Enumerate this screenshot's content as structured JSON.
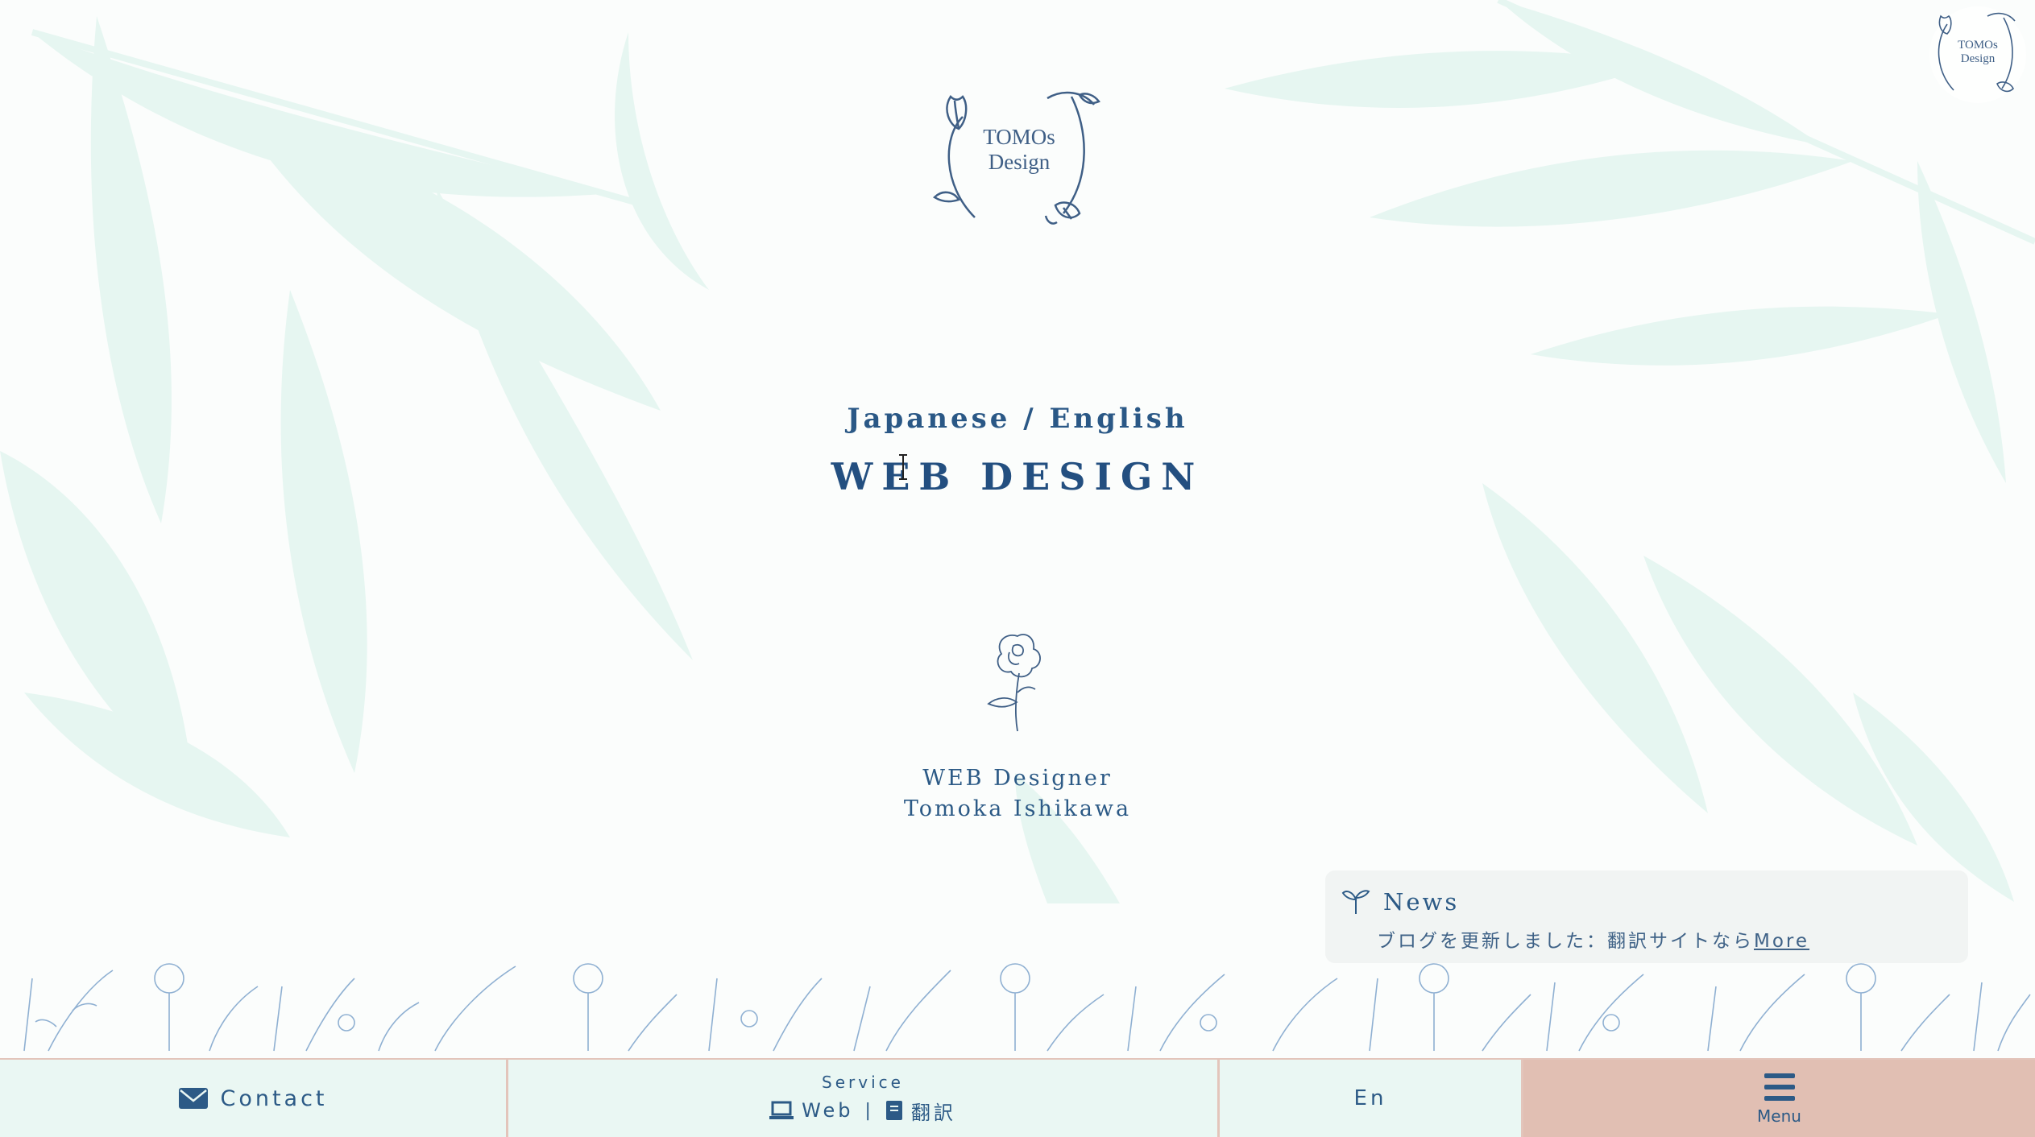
{
  "colors": {
    "background": "#fbfdfc",
    "leaf": "#e6f6f1",
    "primary_text": "#2a5886",
    "bar_background": "#eaf7f3",
    "menu_background": "#e1bfb3",
    "bar_border": "#e3c5bb"
  },
  "logo": {
    "line1": "TOMOs",
    "line2": "Design"
  },
  "corner_logo": {
    "line1": "TOMOs",
    "line2": "Design"
  },
  "hero": {
    "subtitle": "Japanese / English",
    "headline": "WEB DESIGN"
  },
  "profile": {
    "role": "WEB Designer",
    "name": "Tomoka Ishikawa"
  },
  "news": {
    "icon": "sprout-icon",
    "title": "News",
    "body": "ブログを更新しました：翻訳サイトなら",
    "more_label": "More"
  },
  "bottom_bar": {
    "contact": {
      "icon": "envelope-icon",
      "label": "Contact"
    },
    "service": {
      "label": "Service",
      "web": {
        "icon": "laptop-icon",
        "label": "Web"
      },
      "separator": "|",
      "translation": {
        "icon": "book-icon",
        "label": "翻訳"
      }
    },
    "language": {
      "label": "En"
    },
    "menu": {
      "icon": "hamburger-icon",
      "label": "Menu"
    }
  }
}
